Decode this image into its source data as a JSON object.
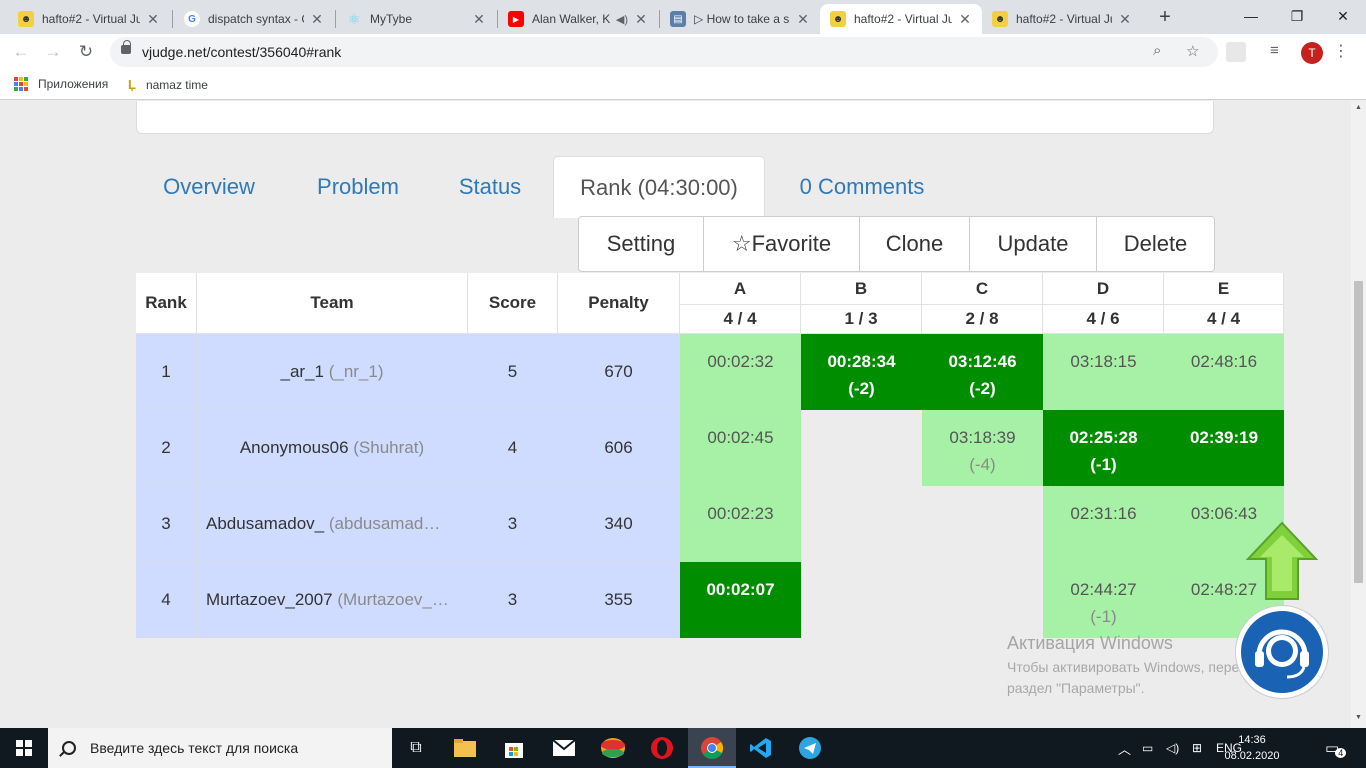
{
  "browser": {
    "tabs": [
      {
        "title": "hafto#2 - Virtual Ju",
        "icon": "vjudge-icon"
      },
      {
        "title": "dispatch syntax - G",
        "icon": "google-icon"
      },
      {
        "title": "MyTybe",
        "icon": "react-icon"
      },
      {
        "title": "Alan Walker, K",
        "icon": "youtube-icon"
      },
      {
        "title": "▷ How to take a s",
        "icon": "page-icon"
      },
      {
        "title": "hafto#2 - Virtual Ju",
        "icon": "vjudge-icon",
        "active": true
      },
      {
        "title": "hafto#2 - Virtual Ju",
        "icon": "vjudge-icon"
      }
    ],
    "url": "vjudge.net/contest/356040#rank",
    "profile_initial": "T",
    "bookmarks": [
      {
        "label": "Приложения",
        "icon": "apps-icon"
      },
      {
        "label": "namaz time",
        "icon": "bookmark-icon"
      }
    ]
  },
  "nav": {
    "overview": "Overview",
    "problem": "Problem",
    "status": "Status",
    "rank": "Rank (04:30:00)",
    "comments": "0 Comments"
  },
  "actions": {
    "setting": "Setting",
    "favorite": "☆Favorite",
    "clone": "Clone",
    "update": "Update",
    "delete": "Delete"
  },
  "table": {
    "headers": {
      "rank": "Rank",
      "team": "Team",
      "score": "Score",
      "penalty": "Penalty"
    },
    "problems": [
      {
        "letter": "A",
        "ratio": "4 / 4"
      },
      {
        "letter": "B",
        "ratio": "1 / 3"
      },
      {
        "letter": "C",
        "ratio": "2 / 8"
      },
      {
        "letter": "D",
        "ratio": "4 / 6"
      },
      {
        "letter": "E",
        "ratio": "4 / 4"
      }
    ],
    "rows": [
      {
        "rank": "1",
        "team": "_ar_1",
        "team_sub": "(_nr_1)",
        "score": "5",
        "penalty": "670",
        "cells": [
          {
            "time": "00:02:32",
            "tries": "",
            "state": "ac"
          },
          {
            "time": "00:28:34",
            "tries": "(-2)",
            "state": "fb"
          },
          {
            "time": "03:12:46",
            "tries": "(-2)",
            "state": "fb"
          },
          {
            "time": "03:18:15",
            "tries": "",
            "state": "ac"
          },
          {
            "time": "02:48:16",
            "tries": "",
            "state": "ac"
          }
        ]
      },
      {
        "rank": "2",
        "team": "Anonymous06",
        "team_sub": "(Shuhrat)",
        "score": "4",
        "penalty": "606",
        "cells": [
          {
            "time": "00:02:45",
            "tries": "",
            "state": "ac"
          },
          {
            "time": "",
            "tries": "",
            "state": "none"
          },
          {
            "time": "03:18:39",
            "tries": "(-4)",
            "state": "ac"
          },
          {
            "time": "02:25:28",
            "tries": "(-1)",
            "state": "fb"
          },
          {
            "time": "02:39:19",
            "tries": "",
            "state": "fb"
          }
        ]
      },
      {
        "rank": "3",
        "team": "Abdusamadov_",
        "team_sub": "(abdusamad…",
        "score": "3",
        "penalty": "340",
        "cells": [
          {
            "time": "00:02:23",
            "tries": "",
            "state": "ac"
          },
          {
            "time": "",
            "tries": "",
            "state": "none"
          },
          {
            "time": "",
            "tries": "",
            "state": "none"
          },
          {
            "time": "02:31:16",
            "tries": "",
            "state": "ac"
          },
          {
            "time": "03:06:43",
            "tries": "",
            "state": "ac"
          }
        ]
      },
      {
        "rank": "4",
        "team": "Murtazoev_2007",
        "team_sub": "(Murtazoev_…",
        "score": "3",
        "penalty": "355",
        "cells": [
          {
            "time": "00:02:07",
            "tries": "",
            "state": "fb"
          },
          {
            "time": "",
            "tries": "",
            "state": "none"
          },
          {
            "time": "",
            "tries": "",
            "state": "none"
          },
          {
            "time": "02:44:27",
            "tries": "(-1)",
            "state": "ac"
          },
          {
            "time": "02:48:27",
            "tries": "",
            "state": "ac"
          }
        ]
      }
    ]
  },
  "activation": {
    "title": "Активация Windows",
    "text": "Чтобы активировать Windows, перейдите в раздел \"Параметры\"."
  },
  "taskbar": {
    "search_placeholder": "Введите здесь текст для поиска",
    "language": "ENG",
    "time": "14:36",
    "date": "08.02.2020",
    "notifications": "4"
  },
  "colors": {
    "accepted": "#a7f1a7",
    "first_blood": "#008d00",
    "row_bg": "#cfdcff",
    "link": "#2e7ab9"
  }
}
